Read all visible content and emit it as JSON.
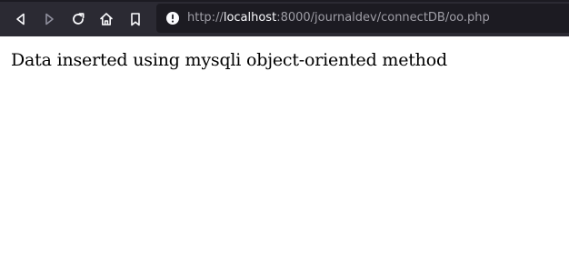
{
  "browser": {
    "url": {
      "scheme": "http://",
      "host": "localhost",
      "rest": ":8000/journaldev/connectDB/oo.php"
    },
    "icons": {
      "back": "back-arrow-icon",
      "forward": "forward-arrow-icon",
      "reload": "reload-icon",
      "home": "home-icon",
      "bookmark": "bookmark-icon",
      "site_info": "info-icon"
    },
    "colors": {
      "toolbar": "#2b2a33",
      "url_bar": "#1c1b22",
      "icon_active": "#fbfbfe",
      "icon_disabled": "#8f8f9d"
    }
  },
  "page": {
    "message": "Data inserted using mysqli object-oriented method"
  }
}
